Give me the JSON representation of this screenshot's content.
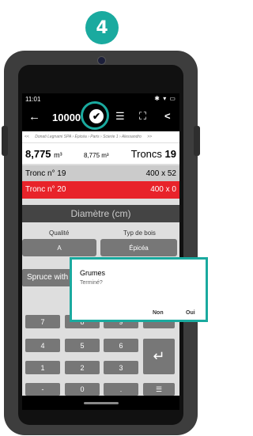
{
  "step": "4",
  "statusbar": {
    "time": "11:01",
    "icons": "✱ ▾ ▭"
  },
  "appbar": {
    "back": "←",
    "number": "10000",
    "check": "✔",
    "list_icon": "☰",
    "expand_icon": "⛶",
    "share_icon": "<"
  },
  "breadcrumb": {
    "prev": "<<",
    "path": "Donati Legnami SPA › Épicéa › Paris › Scierie 1 › Alessandro",
    "next": ">>"
  },
  "summary": {
    "volume": "8,775",
    "volume_unit": "m³",
    "volume_small": "8,775 m³",
    "troncs_label": "Troncs",
    "troncs_count": "19"
  },
  "rows": [
    {
      "label": "Tronc n° 19",
      "value": "400 x 52"
    },
    {
      "label": "Tronc n° 20",
      "value": "400 x 0"
    }
  ],
  "diameter_header": "Diamètre (cm)",
  "quality": {
    "label": "Qualité",
    "value": "A"
  },
  "wood_type": {
    "label": "Typ de bois",
    "value": "Épicéa"
  },
  "spruce_label": "Spruce with",
  "keypad": {
    "row1": [
      "7",
      "8",
      "9"
    ],
    "row2": [
      "4",
      "5",
      "6"
    ],
    "row3": [
      "1",
      "2",
      "3"
    ],
    "row4": [
      "-",
      "0",
      "."
    ],
    "enter": "↵",
    "list": "☰"
  },
  "dialog": {
    "title": "Grumes",
    "message": "Terminé?",
    "no": "Non",
    "yes": "Oui"
  },
  "colors": {
    "accent": "#1aaa9f",
    "red_row": "#e8232a"
  }
}
